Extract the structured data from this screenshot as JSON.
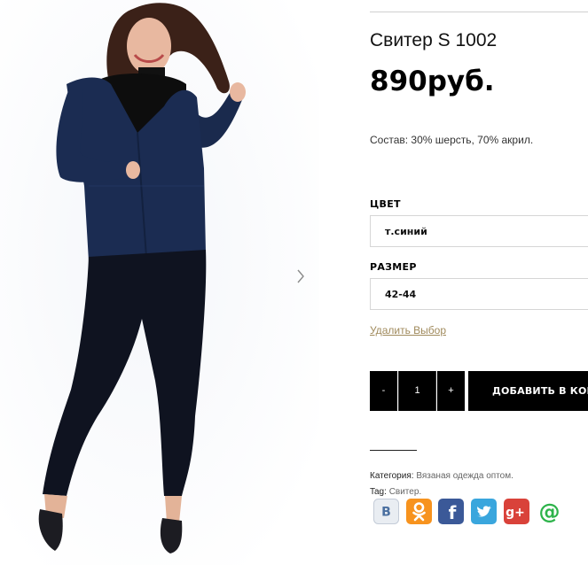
{
  "product": {
    "title": "Свитер S 1002",
    "price": "890руб.",
    "description": "Состав: 30% шерсть, 70% акрил."
  },
  "variations": {
    "color_label": "ЦВЕТ",
    "color_value": "т.синий",
    "size_label": "РАЗМЕР",
    "size_value": "42-44",
    "reset_label": "Удалить Выбор"
  },
  "cart": {
    "minus_label": "-",
    "quantity": "1",
    "plus_label": "+",
    "add_label": "ДОБАВИТЬ В КОРЗИНУ"
  },
  "meta": {
    "category_label": "Категория:",
    "category_value": "Вязаная одежда оптом.",
    "tag_label": "Tag:",
    "tag_value": "Свитер."
  },
  "share": [
    {
      "name": "vk",
      "glyph": "B",
      "color": "#e9edf2"
    },
    {
      "name": "odnoklassniki",
      "glyph": "",
      "color": "#f7931e"
    },
    {
      "name": "facebook",
      "glyph": "f",
      "color": "#3b5998"
    },
    {
      "name": "twitter",
      "glyph": "",
      "color": "#3aa6dd"
    },
    {
      "name": "google-plus",
      "glyph": "g+",
      "color": "#d9423a"
    },
    {
      "name": "mail",
      "glyph": "@",
      "color": "#ffffff"
    }
  ],
  "colors": {
    "accent_link": "#a08a5c",
    "button_bg": "#000000"
  }
}
